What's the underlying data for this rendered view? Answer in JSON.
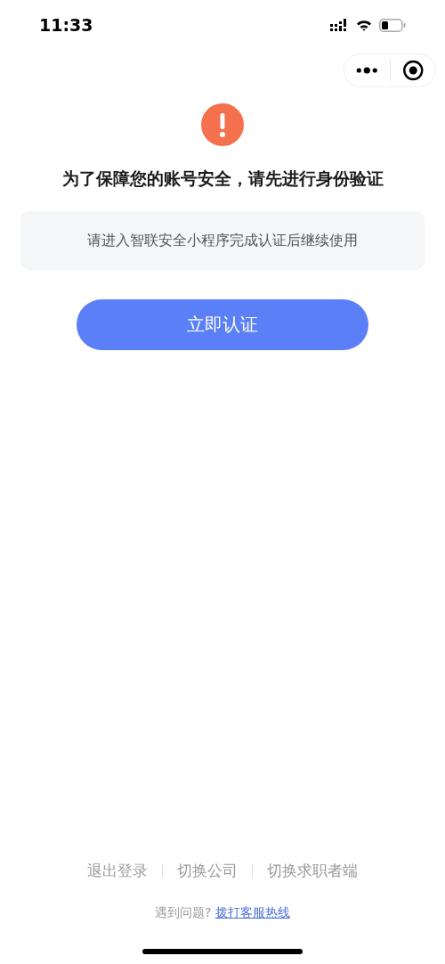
{
  "status_bar": {
    "time": "11:33"
  },
  "message": {
    "title": "为了保障您的账号安全，请先进行身份验证",
    "notice": "请进入智联安全小程序完成认证后继续使用"
  },
  "primary_button": "立即认证",
  "footer_links": [
    "退出登录",
    "切换公司",
    "切换求职者端"
  ],
  "help": {
    "prompt": "遇到问题?",
    "link": "拨打客服热线"
  }
}
